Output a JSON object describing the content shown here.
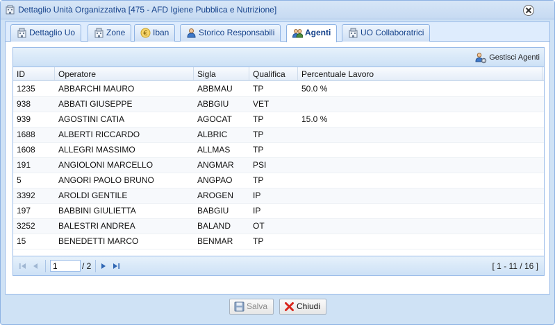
{
  "window": {
    "title": "Dettaglio Unità Organizzativa [475 - AFD Igiene Pubblica e Nutrizione]"
  },
  "tabs": [
    {
      "label": "Dettaglio Uo",
      "icon": "building-icon"
    },
    {
      "label": "Zone",
      "icon": "building-icon"
    },
    {
      "label": "Iban",
      "icon": "euro-icon"
    },
    {
      "label": "Storico Responsabili",
      "icon": "user-icon"
    },
    {
      "label": "Agenti",
      "icon": "users-icon",
      "active": true
    },
    {
      "label": "UO Collaboratrici",
      "icon": "building-icon"
    }
  ],
  "toolbar": {
    "manage_agents_label": "Gestisci Agenti"
  },
  "grid": {
    "columns": [
      "ID",
      "Operatore",
      "Sigla",
      "Qualifica",
      "Percentuale Lavoro"
    ],
    "rows": [
      [
        "1235",
        "ABBARCHI MAURO",
        "ABBMAU",
        "TP",
        "50.0 %"
      ],
      [
        "938",
        "ABBATI GIUSEPPE",
        "ABBGIU",
        "VET",
        ""
      ],
      [
        "939",
        "AGOSTINI CATIA",
        "AGOCAT",
        "TP",
        "15.0 %"
      ],
      [
        "1688",
        "ALBERTI RICCARDO",
        "ALBRIC",
        "TP",
        ""
      ],
      [
        "1608",
        "ALLEGRI MASSIMO",
        "ALLMAS",
        "TP",
        ""
      ],
      [
        "191",
        "ANGIOLONI MARCELLO",
        "ANGMAR",
        "PSI",
        ""
      ],
      [
        "5",
        "ANGORI PAOLO BRUNO",
        "ANGPAO",
        "TP",
        ""
      ],
      [
        "3392",
        "AROLDI GENTILE",
        "AROGEN",
        "IP",
        ""
      ],
      [
        "197",
        "BABBINI GIULIETTA",
        "BABGIU",
        "IP",
        ""
      ],
      [
        "3252",
        "BALESTRI ANDREA",
        "BALAND",
        "OT",
        ""
      ],
      [
        "15",
        "BENEDETTI MARCO",
        "BENMAR",
        "TP",
        ""
      ]
    ]
  },
  "pager": {
    "current_page": "1",
    "of_pages": "/ 2",
    "info": "[ 1 - 11 / 16 ]"
  },
  "footer": {
    "save_label": "Salva",
    "close_label": "Chiudi"
  },
  "colors": {
    "accent": "#15428b",
    "border": "#99bbe8",
    "close_red": "#d9251c"
  }
}
